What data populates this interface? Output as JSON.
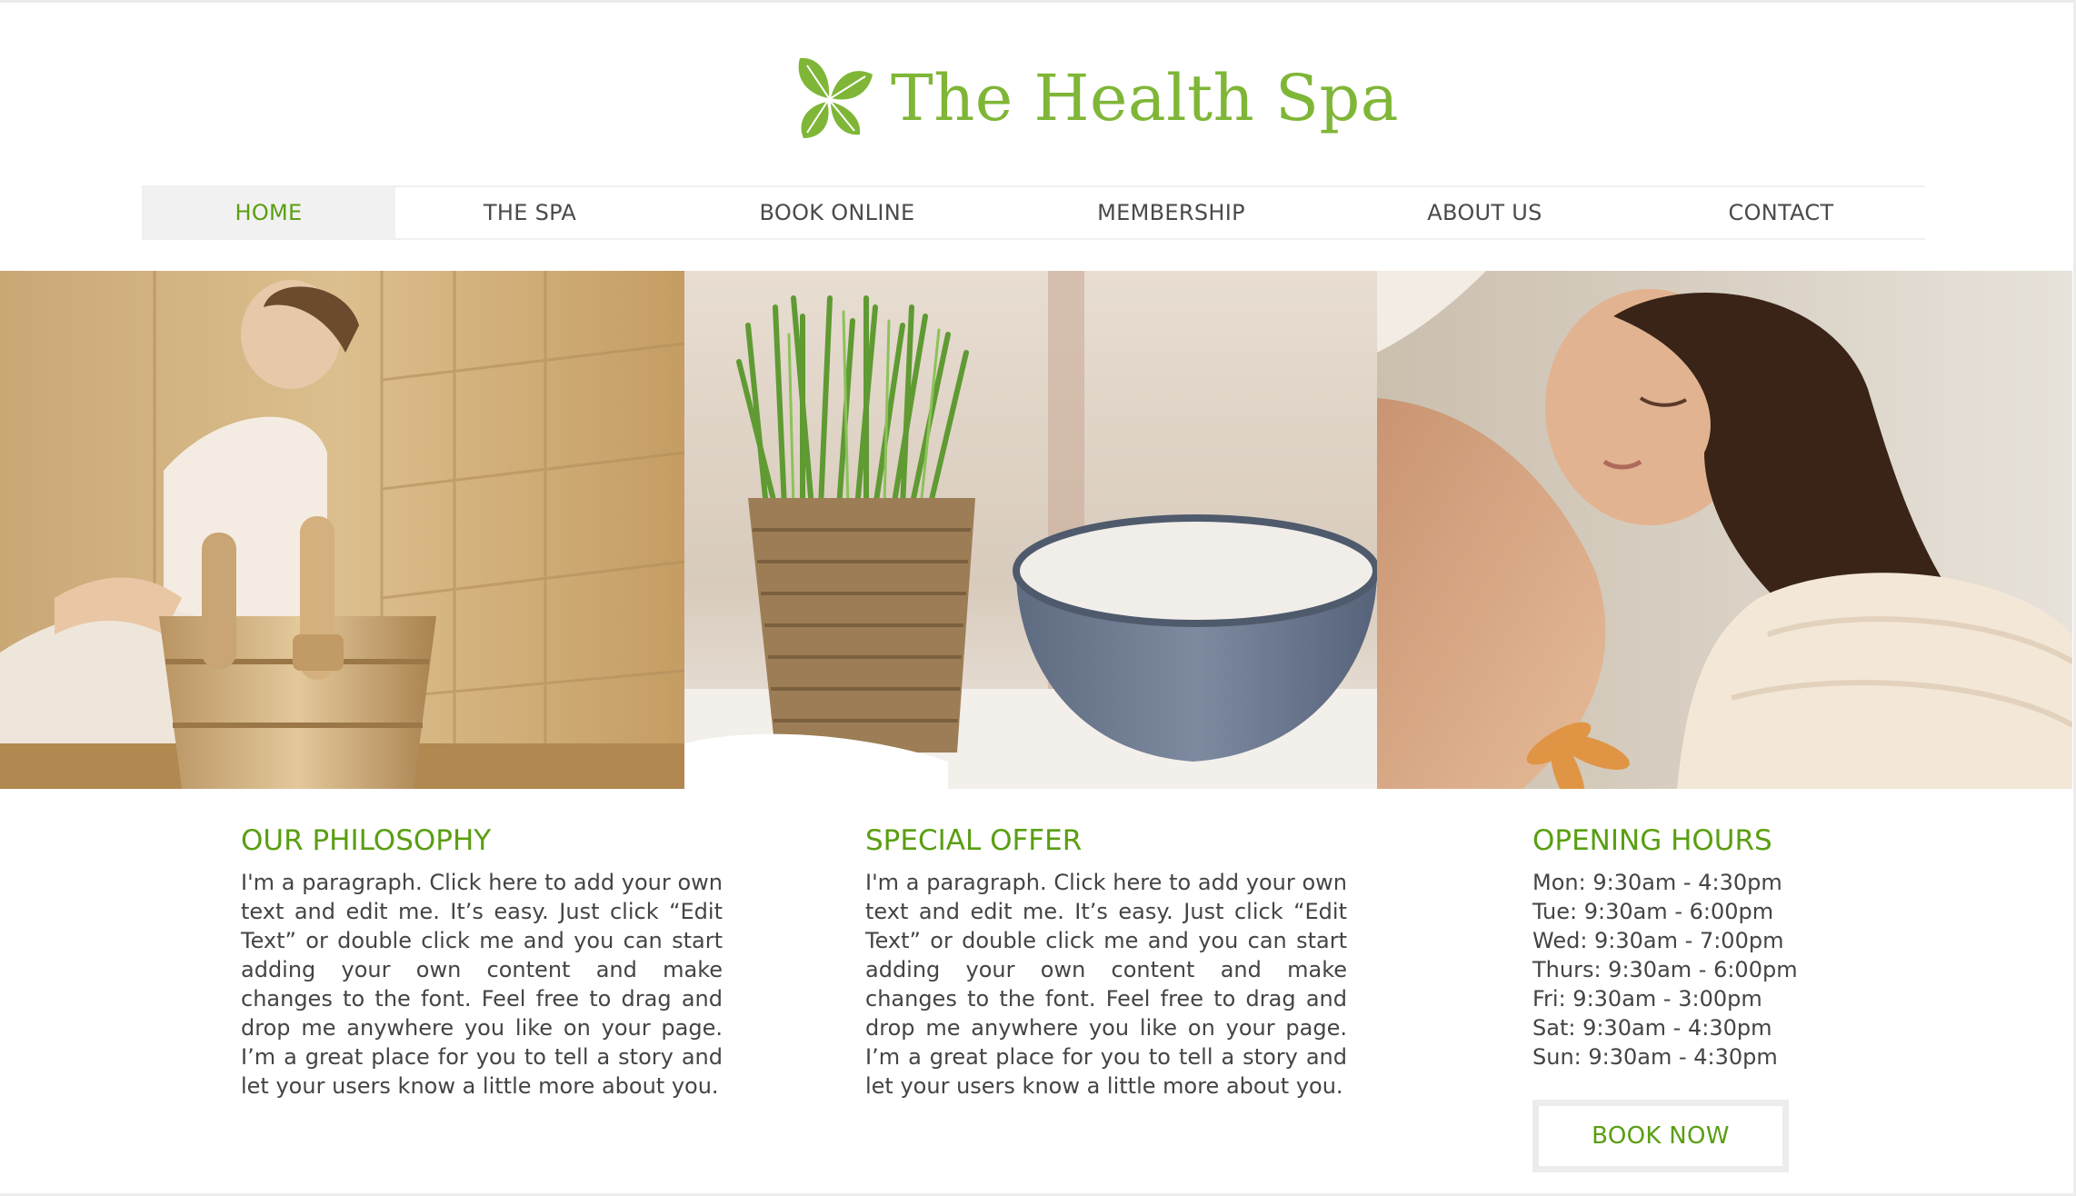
{
  "brand": {
    "name": "The Health Spa",
    "logo_icon": "leaf-icon",
    "accent_color": "#7fb637"
  },
  "nav": {
    "items": [
      {
        "label": "HOME",
        "active": true
      },
      {
        "label": "THE SPA",
        "active": false
      },
      {
        "label": "BOOK ONLINE",
        "active": false
      },
      {
        "label": "MEMBERSHIP",
        "active": false
      },
      {
        "label": "ABOUT US",
        "active": false
      },
      {
        "label": "CONTACT",
        "active": false
      }
    ]
  },
  "hero": {
    "images": [
      {
        "name": "sauna-image"
      },
      {
        "name": "wheatgrass-bowl-image"
      },
      {
        "name": "relaxing-woman-image"
      }
    ]
  },
  "sections": {
    "philosophy": {
      "title": "OUR PHILOSOPHY",
      "text": "I'm a paragraph. Click here to add your own text and edit me. It’s easy. Just click “Edit Text” or double click me and you can start adding your own content and make changes to the font. Feel free to drag and drop me anywhere you like on your page. I’m a great place for you to tell a story and let your users know a little more about you."
    },
    "offer": {
      "title": "SPECIAL OFFER",
      "text": "I'm a paragraph. Click here to add your own text and edit me. It’s easy. Just click “Edit Text” or double click me and you can start adding your own content and make changes to the font. Feel free to drag and drop me anywhere you like on your page. I’m a great place for you to tell a story and let your users know a little more about you."
    },
    "hours": {
      "title": "OPENING HOURS",
      "lines": [
        "Mon: 9:30am - 4:30pm",
        "Tue: 9:30am - 6:00pm",
        "Wed: 9:30am - 7:00pm",
        "Thurs: 9:30am - 6:00pm",
        "Fri: 9:30am - 3:00pm",
        "Sat: 9:30am - 4:30pm",
        "Sun: 9:30am - 4:30pm"
      ],
      "button_label": "BOOK NOW"
    }
  }
}
